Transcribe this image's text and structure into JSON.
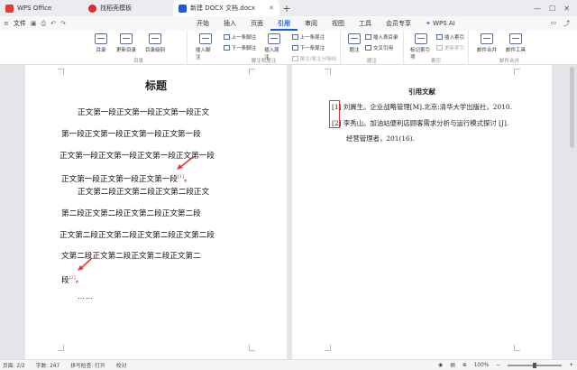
{
  "titlebar": {
    "tabs": [
      {
        "label": "WPS Office"
      },
      {
        "label": "找稻壳模板"
      },
      {
        "label": "新建 DOCX 文档.docx"
      }
    ],
    "new_tab": "+"
  },
  "menubar": {
    "file_label": "文件",
    "items": [
      {
        "label": "开始"
      },
      {
        "label": "插入"
      },
      {
        "label": "页面"
      },
      {
        "label": "引用",
        "active": true
      },
      {
        "label": "审阅"
      },
      {
        "label": "视图"
      },
      {
        "label": "工具"
      },
      {
        "label": "会员专享"
      }
    ],
    "ai_label": "WPS AI"
  },
  "ribbon": {
    "groups": {
      "toc": {
        "label": "目录",
        "buttons": [
          "目录",
          "更新目录",
          "目录级别"
        ]
      },
      "notes": {
        "label": "脚注和尾注",
        "insert_footnote": "插入脚注",
        "prev_footnote": "上一条脚注",
        "next_footnote": "下一条脚注",
        "insert_endnote": "插入尾注",
        "prev_endnote": "上一条尾注",
        "next_endnote": "下一条尾注",
        "convert": "脚注/尾注分隔线"
      },
      "caption": {
        "label": "题注",
        "caption_btn": "题注",
        "insert_table_caption": "插入表目录",
        "cross_ref": "交叉引用"
      },
      "index": {
        "label": "索引",
        "mark_entry": "标记索引项",
        "insert_index": "插入索引",
        "update_index": "更新索引"
      },
      "mail": {
        "label": "邮件合并",
        "mail_merge": "邮件合并",
        "mail_tools": "邮件工具"
      }
    },
    "accent_color": "#1e5bd7"
  },
  "document": {
    "left_page": {
      "title": "标题",
      "para1": [
        "正文第一段正文第一段正文第一段正文",
        "第一段正文第一段正文第一段正文第一段",
        "正文第一段正文第一段正文第一段正文第一段",
        "正文第一段正文第一段正文第一段"
      ],
      "para1_tail": "。",
      "ref1": "[1]",
      "para2": [
        "正文第二段正文第二段正文第二段正文",
        "第二段正文第二段正文第二段正文第二段",
        "正文第二段正文第二段正文第二段正文第二段",
        "文第二段正文第二段正文第二段正文第二"
      ],
      "para2_last": "段",
      "ref2": "[2]",
      "para2_tail": "。",
      "ellipsis": "……"
    },
    "right_page": {
      "heading": "引用文献",
      "refs": [
        "[1] 刘冀生。企业战略管理[M].北京:清华大学出版社，2010.",
        "[2] 李秀山。加油站便利店顾客需求分析与运行模式探讨 [J].",
        "经营管理者，201(16)."
      ],
      "highlight_color": "#e53935"
    }
  },
  "statusbar": {
    "page": "页面: 2/2",
    "words": "字数: 247",
    "spell": "拼写检查: 打开",
    "proof": "校对",
    "zoom": "100%"
  }
}
